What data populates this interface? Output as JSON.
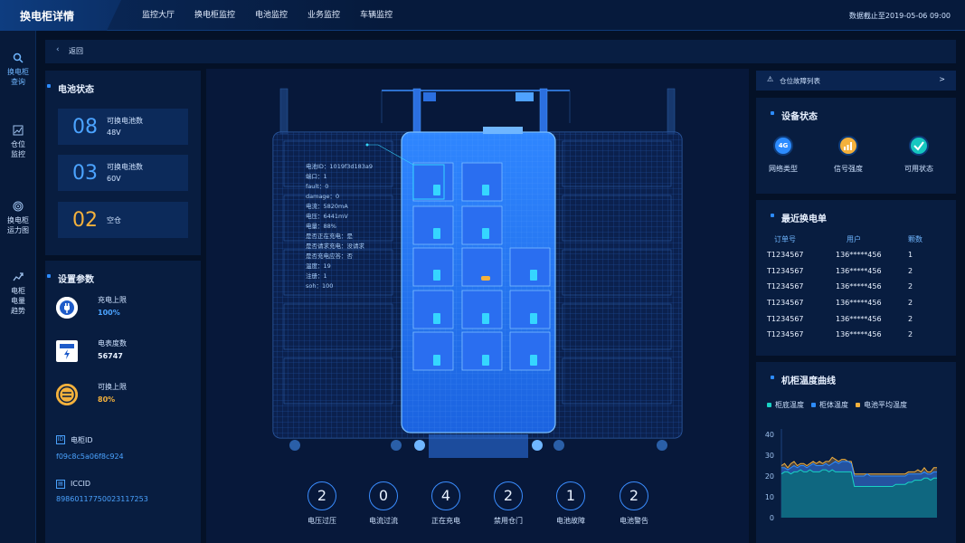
{
  "header": {
    "title": "换电柜详情",
    "nav": [
      "监控大厅",
      "换电柜监控",
      "电池监控",
      "业务监控",
      "车辆监控"
    ],
    "timestamp": "数据截止至2019-05-06 09:00"
  },
  "sidebar": {
    "items": [
      {
        "label_1": "换电柜",
        "label_2": "查询",
        "icon": "search-icon"
      },
      {
        "label_1": "仓位",
        "label_2": "监控",
        "icon": "chart-icon"
      },
      {
        "label_1": "换电柜",
        "label_2": "运力图",
        "icon": "radar-icon"
      },
      {
        "label_1": "电柜",
        "label_2": "电量",
        "label_3": "趋势",
        "icon": "trend-icon"
      }
    ]
  },
  "breadcrumb": {
    "back_label": "返回"
  },
  "battery_status": {
    "title": "电池状态",
    "items": [
      {
        "value": "08",
        "label": "可换电池数",
        "sub": "48V"
      },
      {
        "value": "03",
        "label": "可换电池数",
        "sub": "60V"
      },
      {
        "value": "02",
        "label": "空仓",
        "sub": ""
      }
    ]
  },
  "settings": {
    "title": "设置参数",
    "params": [
      {
        "label": "充电上限",
        "value": "100%",
        "icon": "plug-icon"
      },
      {
        "label": "电表度数",
        "value": "56747",
        "icon": "meter-icon"
      },
      {
        "label": "可换上限",
        "value": "80%",
        "icon": "exchange-icon"
      }
    ],
    "cabinet_id_label": "电柜ID",
    "cabinet_id": "f09c8c5a06f8c924",
    "iccid_label": "ICCID",
    "iccid": "89860117750023117253"
  },
  "cabinet_info": {
    "lines": [
      "电池ID：1019f3d183a9",
      "端口：1",
      "fault：0",
      "damage：0",
      "电流：5820mA",
      "电压：6441mV",
      "电量：88%",
      "是否正在充电：是",
      "是否请求充电：没请求",
      "是否充电应答：否",
      "温度：19",
      "注册：1",
      "soh：100"
    ]
  },
  "counters": [
    {
      "value": "2",
      "label": "电压过压"
    },
    {
      "value": "0",
      "label": "电流过流"
    },
    {
      "value": "4",
      "label": "正在充电"
    },
    {
      "value": "2",
      "label": "禁用仓门"
    },
    {
      "value": "1",
      "label": "电池故障"
    },
    {
      "value": "2",
      "label": "电池警告"
    }
  ],
  "fault_list": {
    "label": "仓位故障列表",
    "arrow": ">"
  },
  "device_status": {
    "title": "设备状态",
    "items": [
      {
        "label": "网络类型",
        "badge": "4G",
        "color": "#2d8cff",
        "icon": "network-icon"
      },
      {
        "label": "信号强度",
        "badge": "",
        "color": "#f4b13c",
        "icon": "signal-icon"
      },
      {
        "label": "可用状态",
        "badge": "",
        "color": "#16c7c0",
        "icon": "check-icon"
      }
    ]
  },
  "orders": {
    "title": "最近换电单",
    "columns": [
      "订单号",
      "用户",
      "颗数"
    ],
    "rows": [
      [
        "T1234567",
        "136*****456",
        "1"
      ],
      [
        "T1234567",
        "136*****456",
        "2"
      ],
      [
        "T1234567",
        "136*****456",
        "2"
      ],
      [
        "T1234567",
        "136*****456",
        "2"
      ],
      [
        "T1234567",
        "136*****456",
        "2"
      ],
      [
        "T1234567",
        "136*****456",
        "2"
      ]
    ]
  },
  "temperature": {
    "title": "机柜温度曲线",
    "legend": [
      {
        "name": "柜底温度",
        "color": "#19d3c5"
      },
      {
        "name": "柜体温度",
        "color": "#2d8cff"
      },
      {
        "name": "电池平均温度",
        "color": "#f4b13c"
      }
    ]
  },
  "chart_data": {
    "type": "area",
    "title": "机柜温度曲线",
    "ylim": [
      0,
      40
    ],
    "yticks": [
      "40",
      "30",
      "20",
      "10",
      "0"
    ],
    "x": [
      0,
      1,
      2,
      3,
      4,
      5,
      6,
      7,
      8,
      9,
      10,
      11,
      12,
      13,
      14,
      15,
      16,
      17,
      18,
      19,
      20,
      21,
      22,
      23,
      24,
      25,
      26,
      27,
      28,
      29,
      30,
      31,
      32,
      33,
      34,
      35,
      36,
      37,
      38,
      39,
      40,
      41,
      42,
      43,
      44,
      45,
      46,
      47,
      48,
      49
    ],
    "series": [
      {
        "name": "柜底温度",
        "color": "#19d3c5",
        "values": [
          21,
          22,
          22,
          21,
          22,
          22,
          23,
          22,
          22,
          23,
          22,
          22,
          22,
          23,
          23,
          22,
          23,
          22,
          22,
          22,
          22,
          22,
          22,
          15,
          15,
          15,
          15,
          15,
          15,
          15,
          15,
          15,
          15,
          15,
          15,
          15,
          16,
          16,
          16,
          16,
          17,
          17,
          18,
          18,
          18,
          19,
          19,
          18,
          19,
          19
        ]
      },
      {
        "name": "柜体温度",
        "color": "#2d8cff",
        "values": [
          24,
          24,
          23,
          24,
          25,
          24,
          25,
          25,
          24,
          25,
          26,
          25,
          25,
          25,
          26,
          25,
          26,
          27,
          26,
          27,
          27,
          27,
          26,
          20,
          20,
          20,
          20,
          21,
          20,
          20,
          20,
          20,
          20,
          20,
          20,
          20,
          20,
          20,
          20,
          20,
          21,
          21,
          21,
          21,
          21,
          22,
          21,
          21,
          22,
          22
        ]
      },
      {
        "name": "电池平均温度",
        "color": "#f4b13c",
        "values": [
          25,
          26,
          24,
          26,
          27,
          25,
          26,
          26,
          25,
          26,
          27,
          26,
          27,
          26,
          27,
          27,
          29,
          28,
          27,
          28,
          28,
          27,
          27,
          21,
          21,
          21,
          21,
          21,
          21,
          21,
          21,
          21,
          21,
          21,
          21,
          21,
          21,
          21,
          21,
          21,
          22,
          22,
          22,
          23,
          22,
          24,
          22,
          22,
          24,
          24
        ]
      }
    ]
  }
}
